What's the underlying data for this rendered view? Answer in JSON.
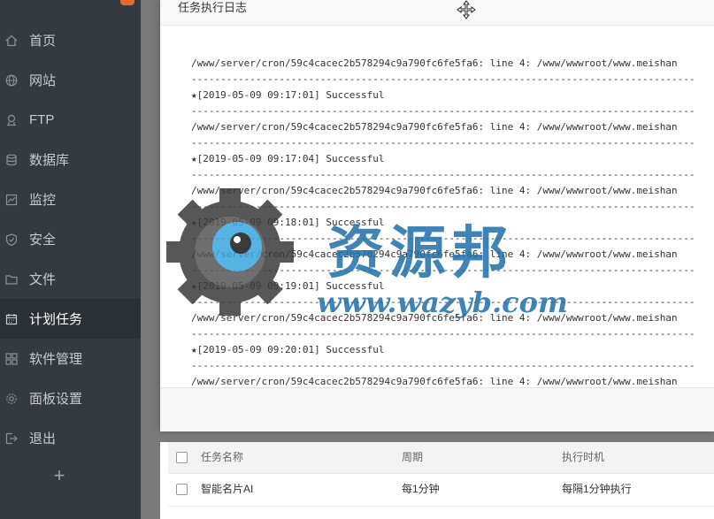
{
  "sidebar": {
    "items": [
      {
        "label": "首页",
        "icon": "home-icon"
      },
      {
        "label": "网站",
        "icon": "globe-icon"
      },
      {
        "label": "FTP",
        "icon": "ftp-icon"
      },
      {
        "label": "数据库",
        "icon": "database-icon"
      },
      {
        "label": "监控",
        "icon": "monitor-icon"
      },
      {
        "label": "安全",
        "icon": "shield-icon"
      },
      {
        "label": "文件",
        "icon": "folder-icon"
      },
      {
        "label": "计划任务",
        "icon": "calendar-icon"
      },
      {
        "label": "软件管理",
        "icon": "apps-icon"
      },
      {
        "label": "面板设置",
        "icon": "gear-icon"
      },
      {
        "label": "退出",
        "icon": "logout-icon"
      }
    ],
    "active_index": 7,
    "add_label": "+"
  },
  "modal": {
    "title": "任务执行日志",
    "log_lines": [
      "/www/server/cron/59c4cacec2b578294c9a790fc6fe5fa6: line 4: /www/wwwroot/www.meishan",
      "--------------------------------------------------------------------------------------",
      "★[2019-05-09 09:17:01] Successful",
      "--------------------------------------------------------------------------------------",
      "/www/server/cron/59c4cacec2b578294c9a790fc6fe5fa6: line 4: /www/wwwroot/www.meishan",
      "--------------------------------------------------------------------------------------",
      "★[2019-05-09 09:17:04] Successful",
      "--------------------------------------------------------------------------------------",
      "/www/server/cron/59c4cacec2b578294c9a790fc6fe5fa6: line 4: /www/wwwroot/www.meishan",
      "--------------------------------------------------------------------------------------",
      "★[2019-05-09 09:18:01] Successful",
      "--------------------------------------------------------------------------------------",
      "/www/server/cron/59c4cacec2b578294c9a790fc6fe5fa6: line 4: /www/wwwroot/www.meishan",
      "--------------------------------------------------------------------------------------",
      "★[2019-05-09 09:19:01] Successful",
      "--------------------------------------------------------------------------------------",
      "/www/server/cron/59c4cacec2b578294c9a790fc6fe5fa6: line 4: /www/wwwroot/www.meishan",
      "--------------------------------------------------------------------------------------",
      "★[2019-05-09 09:20:01] Successful",
      "--------------------------------------------------------------------------------------",
      "/www/server/cron/59c4cacec2b578294c9a790fc6fe5fa6: line 4: /www/wwwroot/www.meishan"
    ]
  },
  "table": {
    "headers": [
      "任务名称",
      "周期",
      "执行时机"
    ],
    "rows": [
      [
        "智能名片AI",
        "每1分钟",
        "每隔1分钟执行"
      ]
    ]
  },
  "watermark": {
    "text": "资源邦",
    "url": "www.wazyb.com"
  },
  "colors": {
    "sidebar_bg": "#333a40",
    "badge": "#e8692c",
    "watermark": "#1e6fa8"
  }
}
